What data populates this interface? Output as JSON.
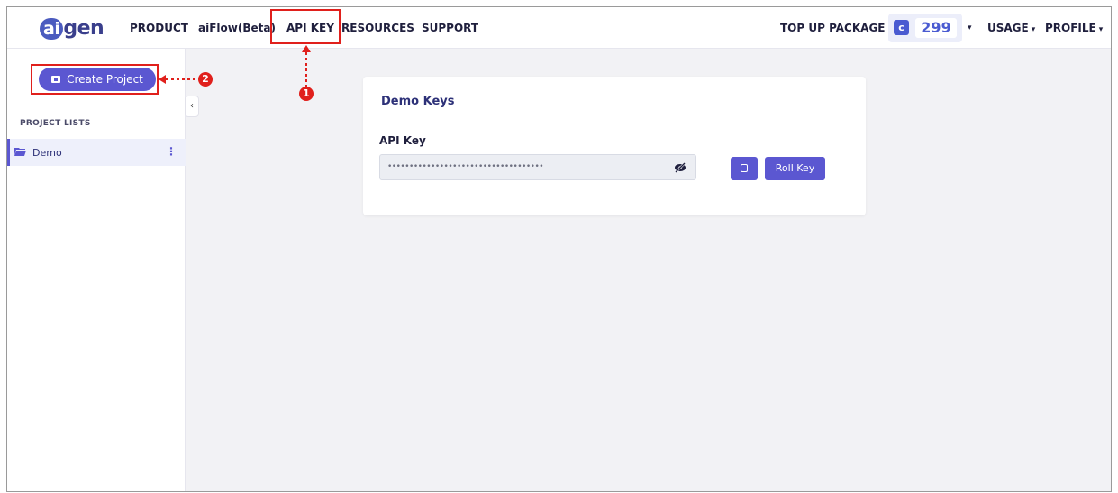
{
  "brand": {
    "logo_ai": "ai",
    "logo_gen": "gen"
  },
  "nav": {
    "product": "PRODUCT",
    "aiflow": "aiFlow(Beta)",
    "api_key": "API KEY",
    "resources": "RESOURCES",
    "support": "SUPPORT",
    "top_up": "TOP UP PACKAGE",
    "credits": "299",
    "usage": "USAGE",
    "profile": "PROFILE"
  },
  "sidebar": {
    "create_project": "Create Project",
    "project_lists": "PROJECT LISTS",
    "projects": [
      {
        "name": "Demo"
      }
    ]
  },
  "card": {
    "title": "Demo Keys",
    "api_key_label": "API Key",
    "api_key_value": "••••••••••••••••••••••••••••••••••••",
    "roll_key": "Roll Key"
  },
  "annotations": {
    "marker_1": "1",
    "marker_2": "2"
  },
  "colors": {
    "accent": "#5b57d1",
    "annotation": "#e0201c",
    "brand": "#3a3f8c"
  }
}
